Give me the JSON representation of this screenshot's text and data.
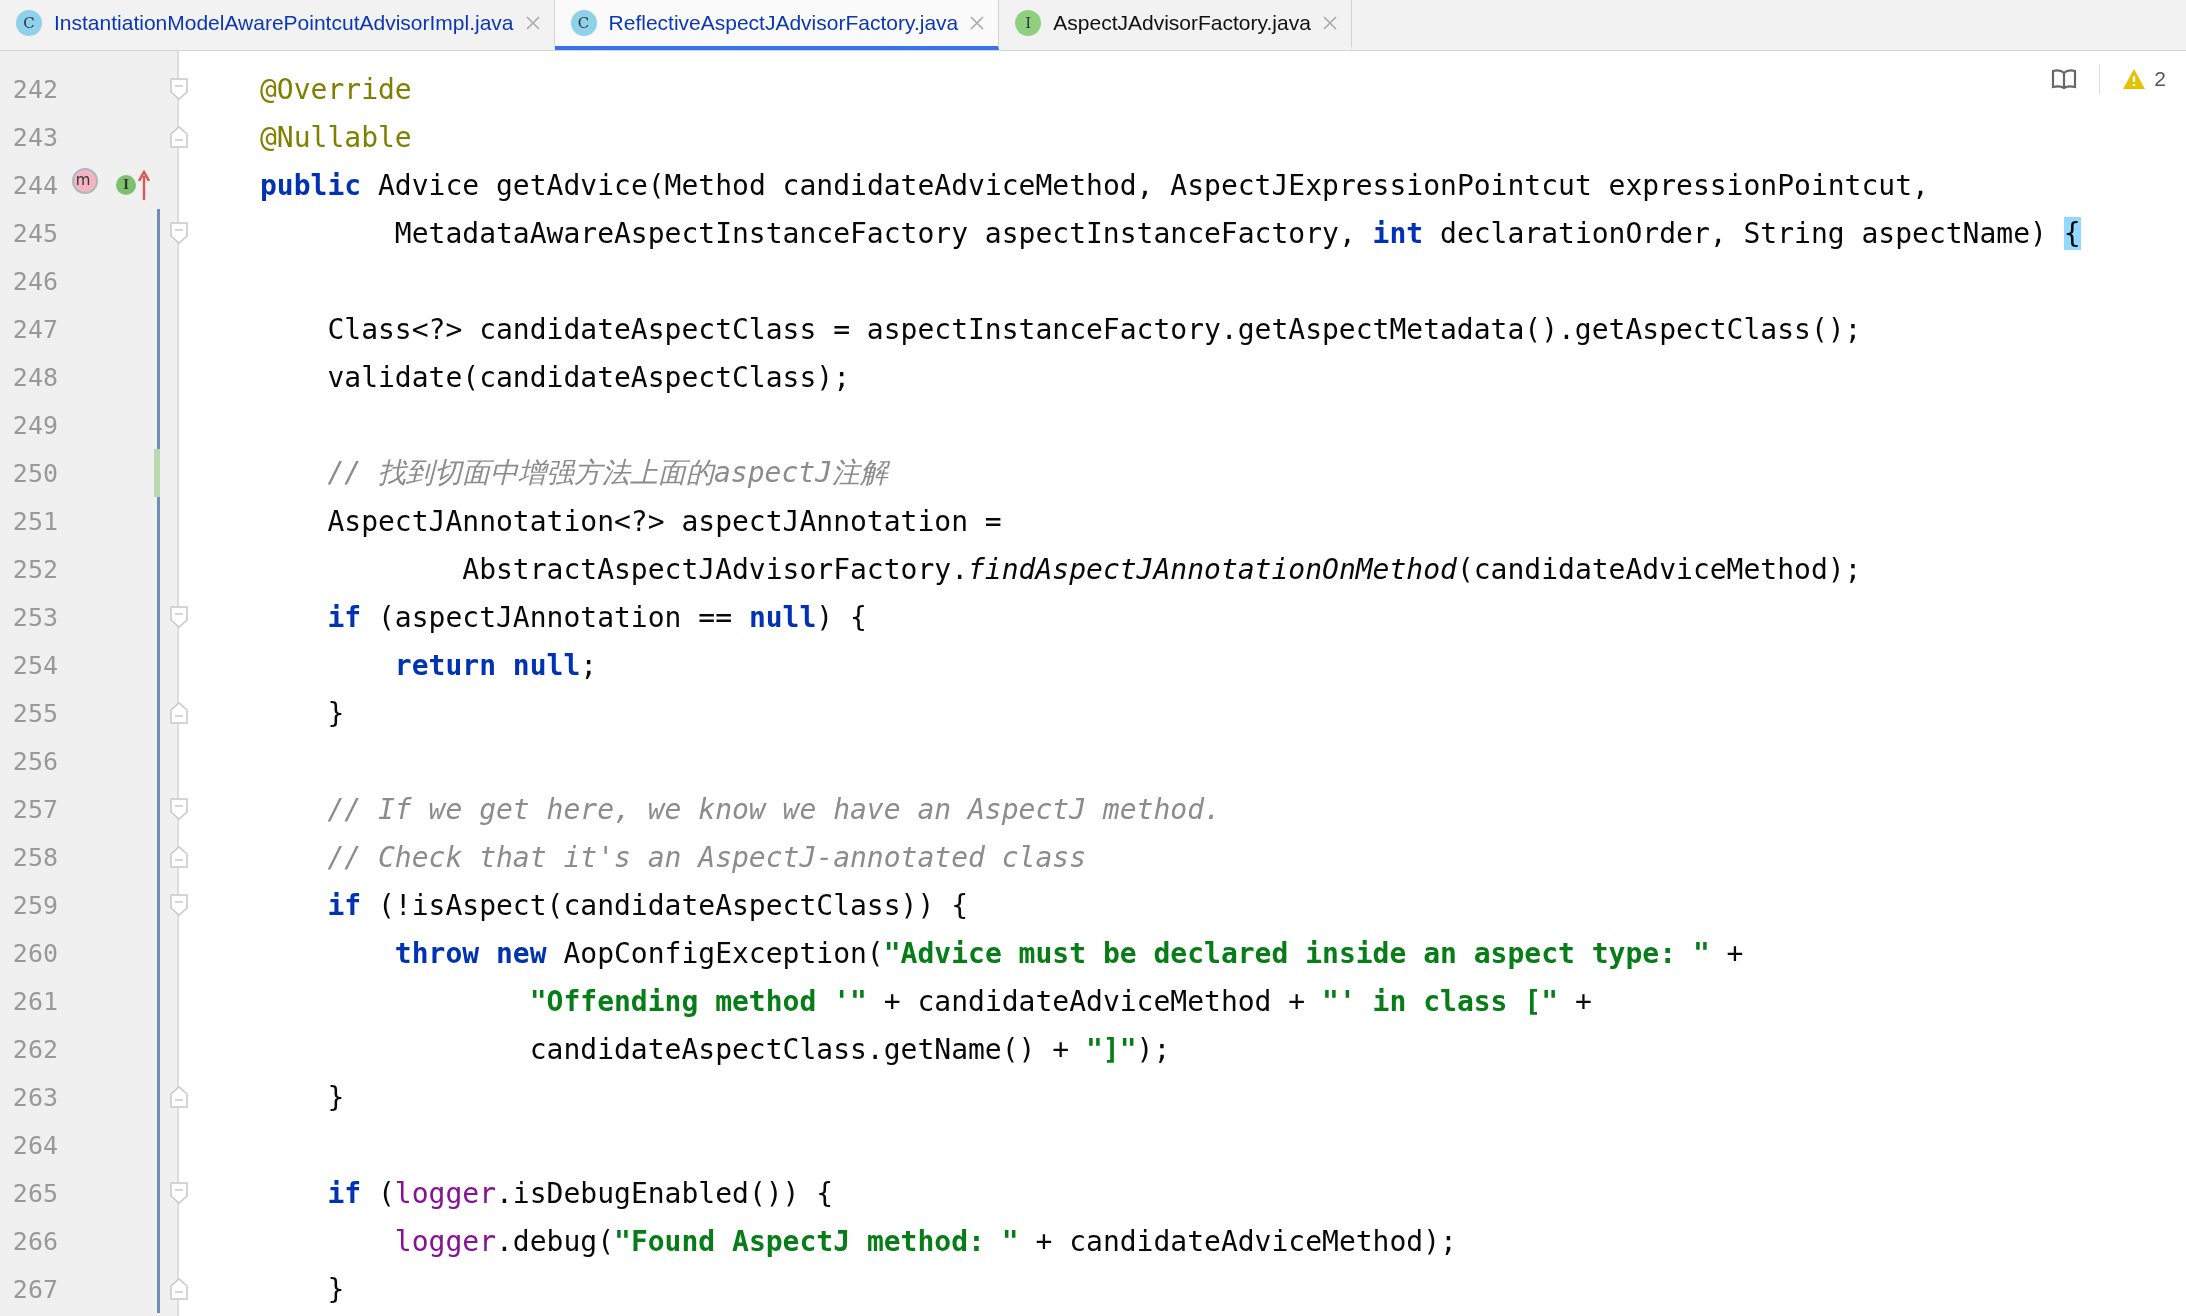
{
  "tabs": [
    {
      "label": "InstantiationModelAwarePointcutAdvisorImpl.java",
      "icon_letter": "C",
      "kind": "class",
      "modified": true,
      "selected": false
    },
    {
      "label": "ReflectiveAspectJAdvisorFactory.java",
      "icon_letter": "C",
      "kind": "class",
      "modified": true,
      "selected": true
    },
    {
      "label": "AspectJAdvisorFactory.java",
      "icon_letter": "I",
      "kind": "interface",
      "modified": false,
      "selected": false
    }
  ],
  "inspections": {
    "warnings": "2"
  },
  "lines": [
    {
      "number": "242",
      "fold_start": true,
      "kind": "indent0",
      "tokens": [
        {
          "kind": "ann",
          "text": "@Override"
        }
      ]
    },
    {
      "number": "243",
      "fold_end": true,
      "kind": "indent0",
      "tokens": [
        {
          "kind": "ann",
          "text": "@Nullable"
        }
      ]
    },
    {
      "number": "244",
      "gutter_icons": {
        "method": "m",
        "implements": "I"
      },
      "kind": "indent0",
      "tokens": [
        {
          "kind": "kw",
          "text": "public"
        },
        {
          "kind": "plain",
          "text": " Advice getAdvice(Method candidateAdviceMethod, AspectJExpressionPointcut expressionPointcut,"
        }
      ]
    },
    {
      "number": "245",
      "fold_start": true,
      "changed": true,
      "kind": "indent2",
      "tokens": [
        {
          "kind": "plain",
          "text": "MetadataAwareAspectInstanceFactory aspectInstanceFactory, "
        },
        {
          "kind": "kw",
          "text": "int"
        },
        {
          "kind": "plain",
          "text": " declarationOrder, String aspectName) "
        },
        {
          "kind": "brace",
          "text": "{"
        }
      ]
    },
    {
      "number": "246",
      "changed": true
    },
    {
      "number": "247",
      "changed": true,
      "kind": "indent1",
      "tokens": [
        {
          "kind": "plain",
          "text": "Class<?> candidateAspectClass = aspectInstanceFactory.getAspectMetadata().getAspectClass();"
        }
      ]
    },
    {
      "number": "248",
      "changed": true,
      "kind": "indent1",
      "tokens": [
        {
          "kind": "plain",
          "text": "validate(candidateAspectClass);"
        }
      ]
    },
    {
      "number": "249",
      "changed": true
    },
    {
      "number": "250",
      "added": true,
      "kind": "indent1",
      "tokens": [
        {
          "kind": "com",
          "text": "// 找到切面中增强方法上面的aspectJ注解"
        }
      ]
    },
    {
      "number": "251",
      "changed": true,
      "kind": "indent1",
      "tokens": [
        {
          "kind": "plain",
          "text": "AspectJAnnotation<?> aspectJAnnotation ="
        }
      ]
    },
    {
      "number": "252",
      "changed": true,
      "kind": "indent3",
      "tokens": [
        {
          "kind": "plain",
          "text": "AbstractAspectJAdvisorFactory."
        },
        {
          "kind": "static",
          "text": "findAspectJAnnotationOnMethod"
        },
        {
          "kind": "plain",
          "text": "(candidateAdviceMethod);"
        }
      ]
    },
    {
      "number": "253",
      "fold_start": true,
      "changed": true,
      "kind": "indent1",
      "tokens": [
        {
          "kind": "kw",
          "text": "if"
        },
        {
          "kind": "plain",
          "text": " (aspectJAnnotation == "
        },
        {
          "kind": "kw",
          "text": "null"
        },
        {
          "kind": "plain",
          "text": ") {"
        }
      ]
    },
    {
      "number": "254",
      "changed": true,
      "kind": "indent2",
      "tokens": [
        {
          "kind": "kw",
          "text": "return null"
        },
        {
          "kind": "plain",
          "text": ";"
        }
      ]
    },
    {
      "number": "255",
      "fold_end": true,
      "changed": true,
      "kind": "indent1",
      "tokens": [
        {
          "kind": "plain",
          "text": "}"
        }
      ]
    },
    {
      "number": "256",
      "changed": true
    },
    {
      "number": "257",
      "fold_start": true,
      "changed": true,
      "kind": "indent1",
      "tokens": [
        {
          "kind": "com",
          "text": "// If we get here, we know we have an AspectJ method."
        }
      ]
    },
    {
      "number": "258",
      "fold_end": true,
      "changed": true,
      "kind": "indent1",
      "tokens": [
        {
          "kind": "com",
          "text": "// Check that it's an AspectJ-annotated class"
        }
      ]
    },
    {
      "number": "259",
      "fold_start": true,
      "changed": true,
      "kind": "indent1",
      "tokens": [
        {
          "kind": "kw",
          "text": "if"
        },
        {
          "kind": "plain",
          "text": " (!isAspect(candidateAspectClass)) {"
        }
      ]
    },
    {
      "number": "260",
      "changed": true,
      "kind": "indent2",
      "tokens": [
        {
          "kind": "kw",
          "text": "throw new"
        },
        {
          "kind": "plain",
          "text": " AopConfigException("
        },
        {
          "kind": "str",
          "text": "\"Advice must be declared inside an aspect type: \""
        },
        {
          "kind": "plain",
          "text": " +"
        }
      ]
    },
    {
      "number": "261",
      "changed": true,
      "kind": "indent4",
      "tokens": [
        {
          "kind": "str",
          "text": "\"Offending method '\""
        },
        {
          "kind": "plain",
          "text": " + candidateAdviceMethod + "
        },
        {
          "kind": "str",
          "text": "\"' in class [\""
        },
        {
          "kind": "plain",
          "text": " +"
        }
      ]
    },
    {
      "number": "262",
      "changed": true,
      "kind": "indent4",
      "tokens": [
        {
          "kind": "plain",
          "text": "candidateAspectClass.getName() + "
        },
        {
          "kind": "str",
          "text": "\"]\""
        },
        {
          "kind": "plain",
          "text": ");"
        }
      ]
    },
    {
      "number": "263",
      "fold_end": true,
      "changed": true,
      "kind": "indent1",
      "tokens": [
        {
          "kind": "plain",
          "text": "}"
        }
      ]
    },
    {
      "number": "264",
      "changed": true
    },
    {
      "number": "265",
      "fold_start": true,
      "changed": true,
      "kind": "indent1",
      "tokens": [
        {
          "kind": "kw",
          "text": "if"
        },
        {
          "kind": "plain",
          "text": " ("
        },
        {
          "kind": "field",
          "text": "logger"
        },
        {
          "kind": "plain",
          "text": ".isDebugEnabled()) {"
        }
      ]
    },
    {
      "number": "266",
      "changed": true,
      "kind": "indent2",
      "tokens": [
        {
          "kind": "field",
          "text": "logger"
        },
        {
          "kind": "plain",
          "text": ".debug("
        },
        {
          "kind": "str",
          "text": "\"Found AspectJ method: \""
        },
        {
          "kind": "plain",
          "text": " + candidateAdviceMethod);"
        }
      ]
    },
    {
      "number": "267",
      "fold_end": true,
      "changed": true,
      "kind": "indent1",
      "tokens": [
        {
          "kind": "plain",
          "text": "}"
        }
      ]
    }
  ]
}
